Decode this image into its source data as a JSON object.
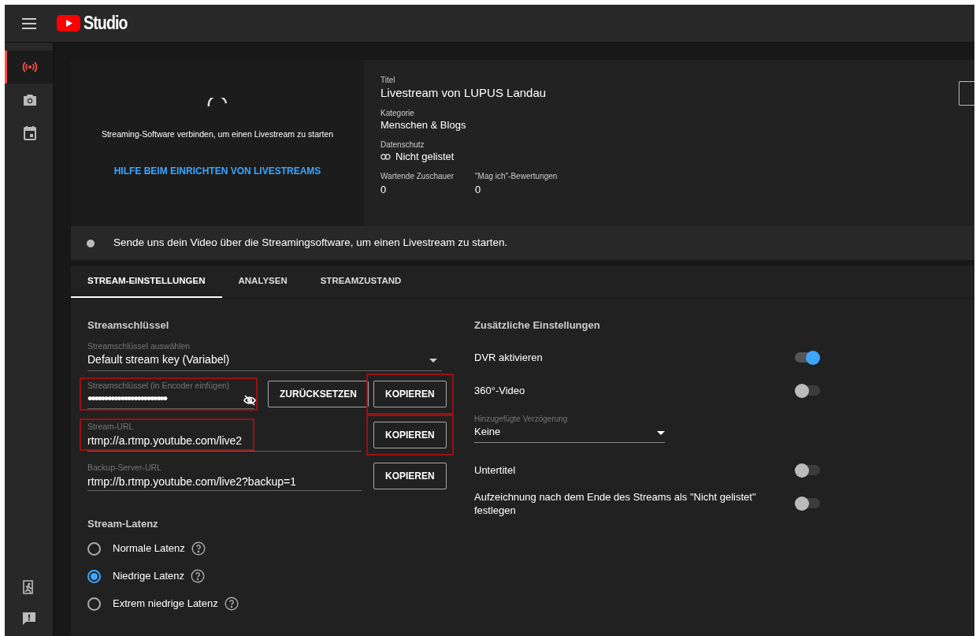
{
  "header": {
    "logo_text": "Studio"
  },
  "sidebar": {
    "items": [
      {
        "kind": "live",
        "selected": true
      },
      {
        "kind": "camera",
        "selected": false
      },
      {
        "kind": "calendar",
        "selected": false
      }
    ],
    "bottom_items": [
      {
        "kind": "exit"
      },
      {
        "kind": "feedback"
      }
    ]
  },
  "preview": {
    "message": "Streaming-Software verbinden, um einen Livestream zu starten",
    "help_link": "HILFE BEIM EINRICHTEN VON LIVESTREAMS"
  },
  "details": {
    "fields": [
      {
        "label": "Titel",
        "value": "Livestream von LUPUS Landau",
        "kind": "title"
      },
      {
        "label": "Kategorie",
        "value": "Menschen & Blogs",
        "kind": "plain"
      },
      {
        "label": "Datenschutz",
        "value": "Nicht gelistet",
        "kind": "privacy"
      }
    ],
    "stats": [
      {
        "label": "Wartende Zuschauer",
        "value": "0"
      },
      {
        "label": "\"Mag ich\"-Bewertungen",
        "value": "0"
      }
    ]
  },
  "status": {
    "message": "Sende uns dein Video über die Streamingsoftware, um einen Livestream zu starten."
  },
  "tabs": [
    {
      "label": "STREAM-EINSTELLUNGEN",
      "selected": true
    },
    {
      "label": "ANALYSEN",
      "selected": false
    },
    {
      "label": "STREAMZUSTAND",
      "selected": false
    }
  ],
  "stream_key": {
    "heading": "Streamschlüssel",
    "select": {
      "label": "Streamschlüssel auswählen",
      "value": "Default stream key (Variabel)"
    },
    "fields": [
      {
        "kind": "secret",
        "label": "Streamschlüssel (in Encoder einfügen)",
        "value": "••••••••••••••••••••••••",
        "highlighted": true,
        "buttons": [
          {
            "label": "ZURÜCKSETZEN",
            "highlighted": false
          },
          {
            "label": "KOPIEREN",
            "highlighted": true
          }
        ]
      },
      {
        "kind": "url",
        "label": "Stream-URL",
        "value": "rtmp://a.rtmp.youtube.com/live2",
        "highlighted": true,
        "buttons": [
          {
            "label": "KOPIEREN",
            "highlighted": true
          }
        ]
      },
      {
        "kind": "url",
        "label": "Backup-Server-URL",
        "value": "rtmp://b.rtmp.youtube.com/live2?backup=1",
        "highlighted": false,
        "buttons": [
          {
            "label": "KOPIEREN",
            "highlighted": false
          }
        ]
      }
    ]
  },
  "latency": {
    "heading": "Stream-Latenz",
    "options": [
      {
        "label": "Normale Latenz",
        "selected": false
      },
      {
        "label": "Niedrige Latenz",
        "selected": true
      },
      {
        "label": "Extrem niedrige Latenz",
        "selected": false
      }
    ]
  },
  "additional": {
    "heading": "Zusätzliche Einstellungen",
    "items": [
      {
        "kind": "toggle",
        "label": "DVR aktivieren",
        "on": true
      },
      {
        "kind": "toggle",
        "label": "360°-Video",
        "on": false
      },
      {
        "kind": "select",
        "label": "Hinzugefügte Verzögerung",
        "value": "Keine"
      },
      {
        "kind": "toggle",
        "label": "Untertitel",
        "on": false
      },
      {
        "kind": "toggle",
        "label": "Aufzeichnung nach dem Ende des Streams als \"Nicht gelistet\" festlegen",
        "on": false
      }
    ]
  }
}
